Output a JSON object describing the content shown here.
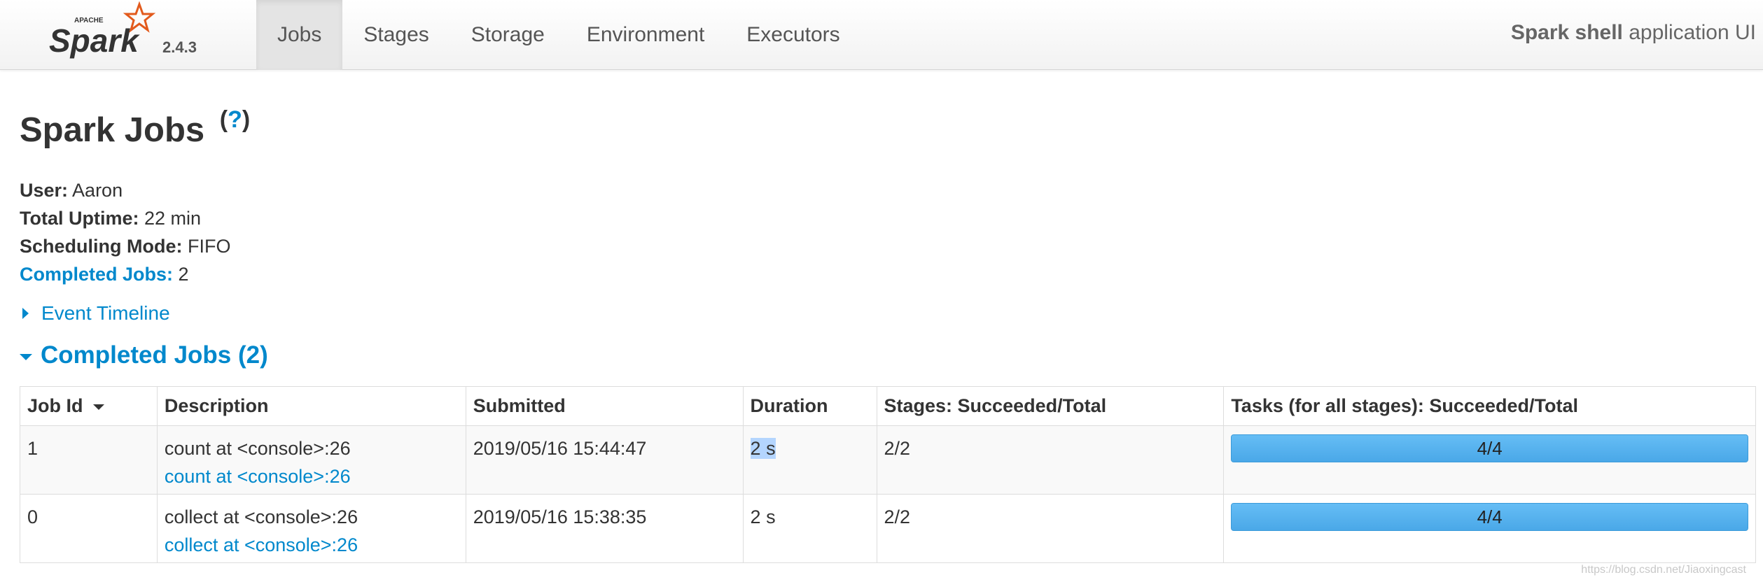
{
  "navbar": {
    "brand_name": "Spark",
    "brand_apache": "APACHE",
    "version": "2.4.3",
    "tabs": [
      {
        "label": "Jobs",
        "active": true
      },
      {
        "label": "Stages",
        "active": false
      },
      {
        "label": "Storage",
        "active": false
      },
      {
        "label": "Environment",
        "active": false
      },
      {
        "label": "Executors",
        "active": false
      }
    ],
    "app_name": "Spark shell",
    "app_suffix": " application UI"
  },
  "page": {
    "title": "Spark Jobs",
    "help_open": "(",
    "help_q": "?",
    "help_close": ")"
  },
  "summary": {
    "user_label": "User:",
    "user_value": " Aaron",
    "uptime_label": "Total Uptime:",
    "uptime_value": " 22 min",
    "scheduling_label": "Scheduling Mode:",
    "scheduling_value": " FIFO",
    "completed_label": "Completed Jobs:",
    "completed_value": " 2"
  },
  "event_timeline": {
    "label": "Event Timeline"
  },
  "completed_jobs": {
    "heading": "Completed Jobs (2)",
    "columns": [
      "Job Id",
      "Description",
      "Submitted",
      "Duration",
      "Stages: Succeeded/Total",
      "Tasks (for all stages): Succeeded/Total"
    ],
    "rows": [
      {
        "job_id": "1",
        "description": "count at <console>:26",
        "description_link": "count at <console>:26",
        "submitted": "2019/05/16 15:44:47",
        "duration": "2 s",
        "stages": "2/2",
        "tasks": "4/4",
        "tasks_fraction": 1.0
      },
      {
        "job_id": "0",
        "description": "collect at <console>:26",
        "description_link": "collect at <console>:26",
        "submitted": "2019/05/16 15:38:35",
        "duration": "2 s",
        "stages": "2/2",
        "tasks": "4/4",
        "tasks_fraction": 1.0
      }
    ]
  },
  "watermark": "https://blog.csdn.net/Jiaoxingcast",
  "colors": {
    "link": "#0088cc",
    "progress": "#5ab4f0",
    "spark_orange": "#e25a1c",
    "text": "#333333"
  },
  "icons": {
    "spark_logo": "spark-star-logo",
    "sort": "sort-desc-caret-icon",
    "expand": "triangle-right-icon",
    "collapse": "triangle-down-icon"
  }
}
